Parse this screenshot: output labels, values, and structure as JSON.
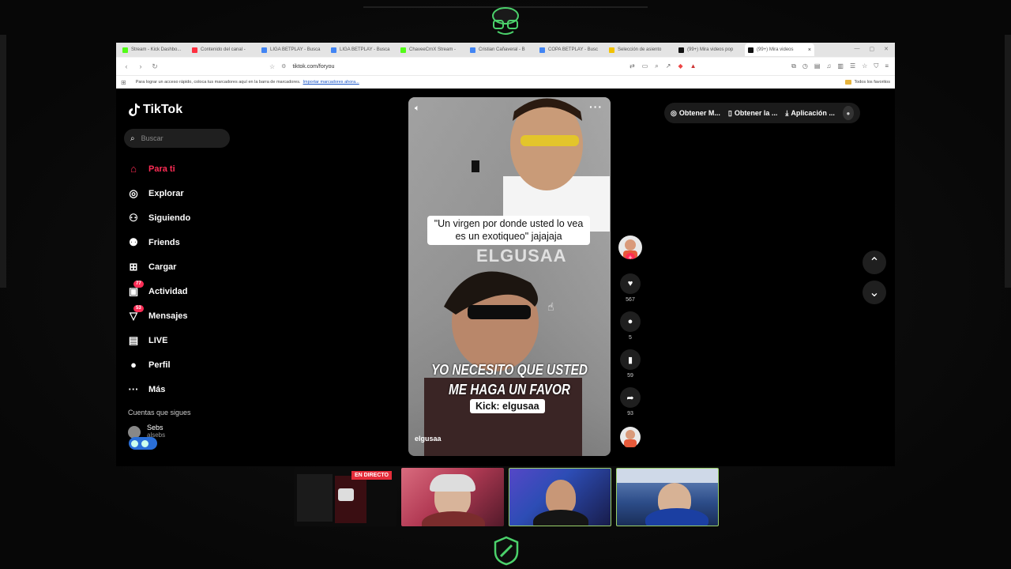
{
  "browser": {
    "tabs": [
      {
        "label": "Stream - Kick Dashbo...",
        "color": "#53fc18"
      },
      {
        "label": "Contenido del canal -",
        "color": "#ff3040"
      },
      {
        "label": "LIGA BETPLAY - Busca",
        "color": "#4285f4"
      },
      {
        "label": "LIGA BETPLAY - Busca",
        "color": "#4285f4"
      },
      {
        "label": "ChaveeCrnX Stream -",
        "color": "#53fc18"
      },
      {
        "label": "Cristian Cañaveral - B",
        "color": "#4285f4"
      },
      {
        "label": "COPA BETPLAY - Busc",
        "color": "#4285f4"
      },
      {
        "label": "Selección de asiento",
        "color": "#f2c200"
      },
      {
        "label": "(99+) Mira videos pop",
        "color": "#111111"
      },
      {
        "label": "(99+) Mira videos",
        "color": "#111111"
      }
    ],
    "url": "tiktok.com/foryou",
    "bookmarks_hint": "Para lograr un acceso rápido, coloca tus marcadores aquí en la barra de marcadores.",
    "bookmarks_link": "Importar marcadores ahora...",
    "all_favorites": "Todos los favoritos"
  },
  "tiktok": {
    "brand": "TikTok",
    "search_placeholder": "Buscar",
    "nav": [
      {
        "label": "Para ti",
        "icon": "home-icon",
        "active": true
      },
      {
        "label": "Explorar",
        "icon": "compass-icon"
      },
      {
        "label": "Siguiendo",
        "icon": "user-follow-icon"
      },
      {
        "label": "Friends",
        "icon": "friends-icon"
      },
      {
        "label": "Cargar",
        "icon": "upload-icon"
      },
      {
        "label": "Actividad",
        "icon": "activity-icon",
        "badge": "77"
      },
      {
        "label": "Mensajes",
        "icon": "messages-icon",
        "badge": "53"
      },
      {
        "label": "LIVE",
        "icon": "live-icon"
      },
      {
        "label": "Perfil",
        "icon": "profile-icon"
      },
      {
        "label": "Más",
        "icon": "more-icon"
      }
    ],
    "following_title": "Cuentas que sigues",
    "following_user": {
      "name": "Sebs",
      "handle": "alsebs"
    },
    "video": {
      "caption_top": "\"Un virgen por donde usted lo vea es un exotiqueo\" jajajaja",
      "watermark": "ELGUSAA",
      "caption_bottom": "YO NECESITO QUE USTED ME HAGA UN FAVOR",
      "caption_kick": "Kick: elgusaa",
      "author": "elgusaa"
    },
    "actions": {
      "likes": "567",
      "comments": "5",
      "saves": "59",
      "shares": "93"
    },
    "top_right": {
      "item1": "Obtener M...",
      "item2": "Obtener la ...",
      "item3": "Aplicación ..."
    }
  },
  "cams": {
    "live_badge": "EN DIRECTO"
  },
  "colors": {
    "accent": "#fe2c55",
    "frame_green": "#4bd16b"
  }
}
